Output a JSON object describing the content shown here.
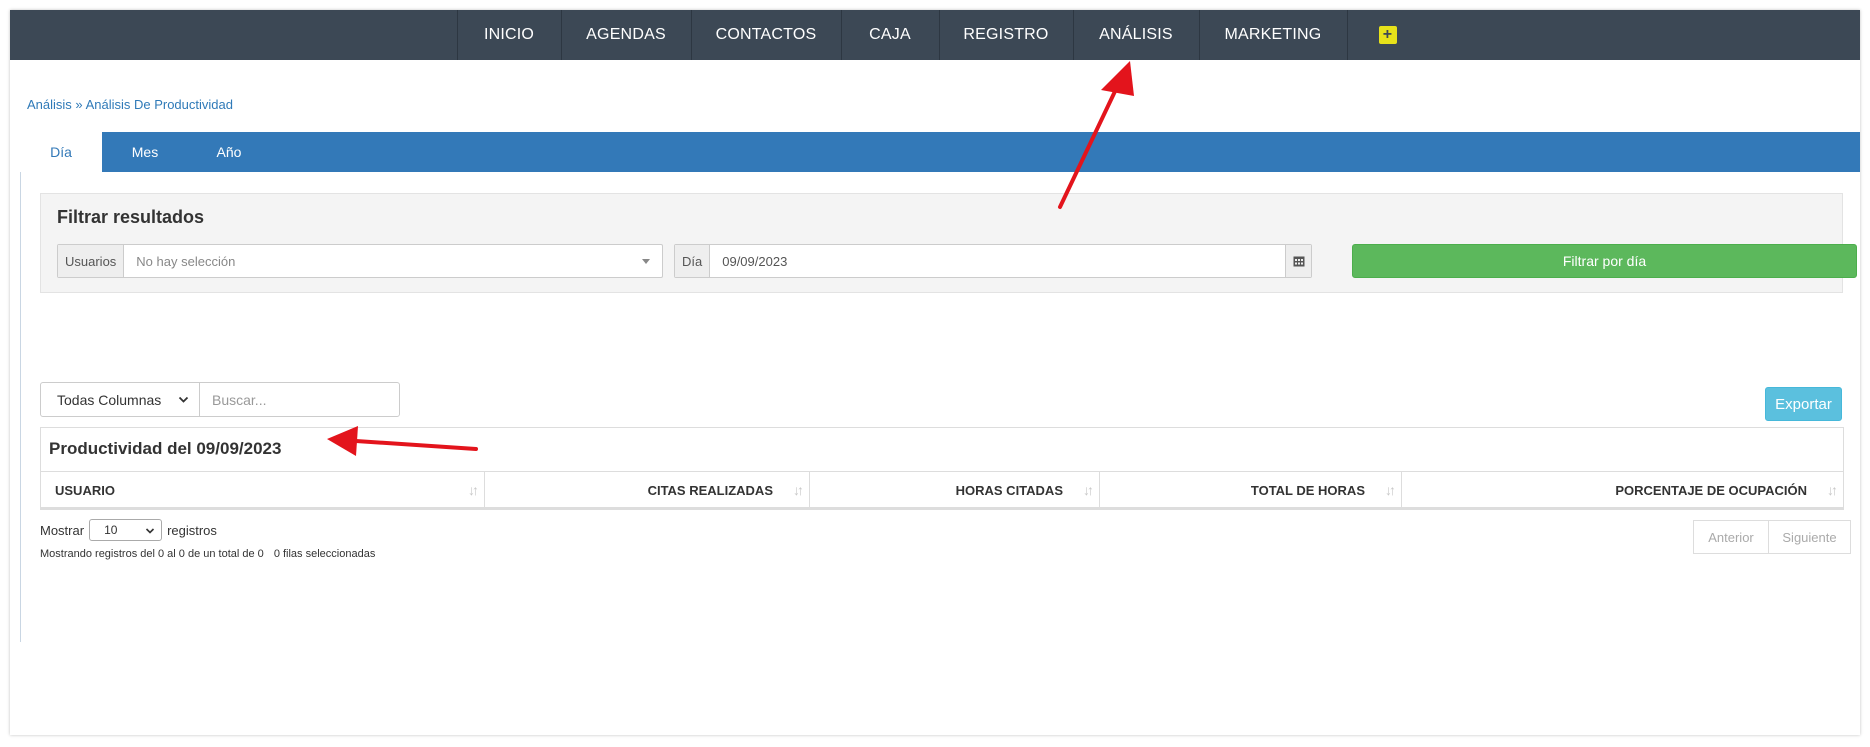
{
  "topnav": {
    "items": [
      "INICIO",
      "AGENDAS",
      "CONTACTOS",
      "CAJA",
      "REGISTRO",
      "ANÁLISIS",
      "MARKETING"
    ],
    "plus_label": "+"
  },
  "breadcrumb": {
    "root": "Análisis",
    "separator": "»",
    "current": "Análisis De Productividad"
  },
  "tabs": [
    "Día",
    "Mes",
    "Año"
  ],
  "filter": {
    "title": "Filtrar resultados",
    "users_label": "Usuarios",
    "users_value": "No hay selección",
    "day_label": "Día",
    "day_value": "09/09/2023",
    "submit_label": "Filtrar por día"
  },
  "table_tools": {
    "column_select": "Todas Columnas",
    "search_placeholder": "Buscar...",
    "export_label": "Exportar"
  },
  "table": {
    "caption": "Productividad del 09/09/2023",
    "headers": [
      "USUARIO",
      "CITAS REALIZADAS",
      "HORAS CITADAS",
      "TOTAL DE HORAS",
      "PORCENTAJE DE OCUPACIÓN"
    ]
  },
  "footer": {
    "show_label": "Mostrar",
    "page_length": "10",
    "records_label": "registros",
    "info": "Mostrando registros del 0 al 0 de un total de 0",
    "selected_info": "0 filas seleccionadas",
    "prev_label": "Anterior",
    "next_label": "Siguiente"
  },
  "colors": {
    "nav_bg": "#3c4855",
    "tab_bar": "#3379b8",
    "filter_button": "#5cb85c",
    "export_button": "#5bc0de",
    "annotation_arrow": "#e3141c"
  }
}
